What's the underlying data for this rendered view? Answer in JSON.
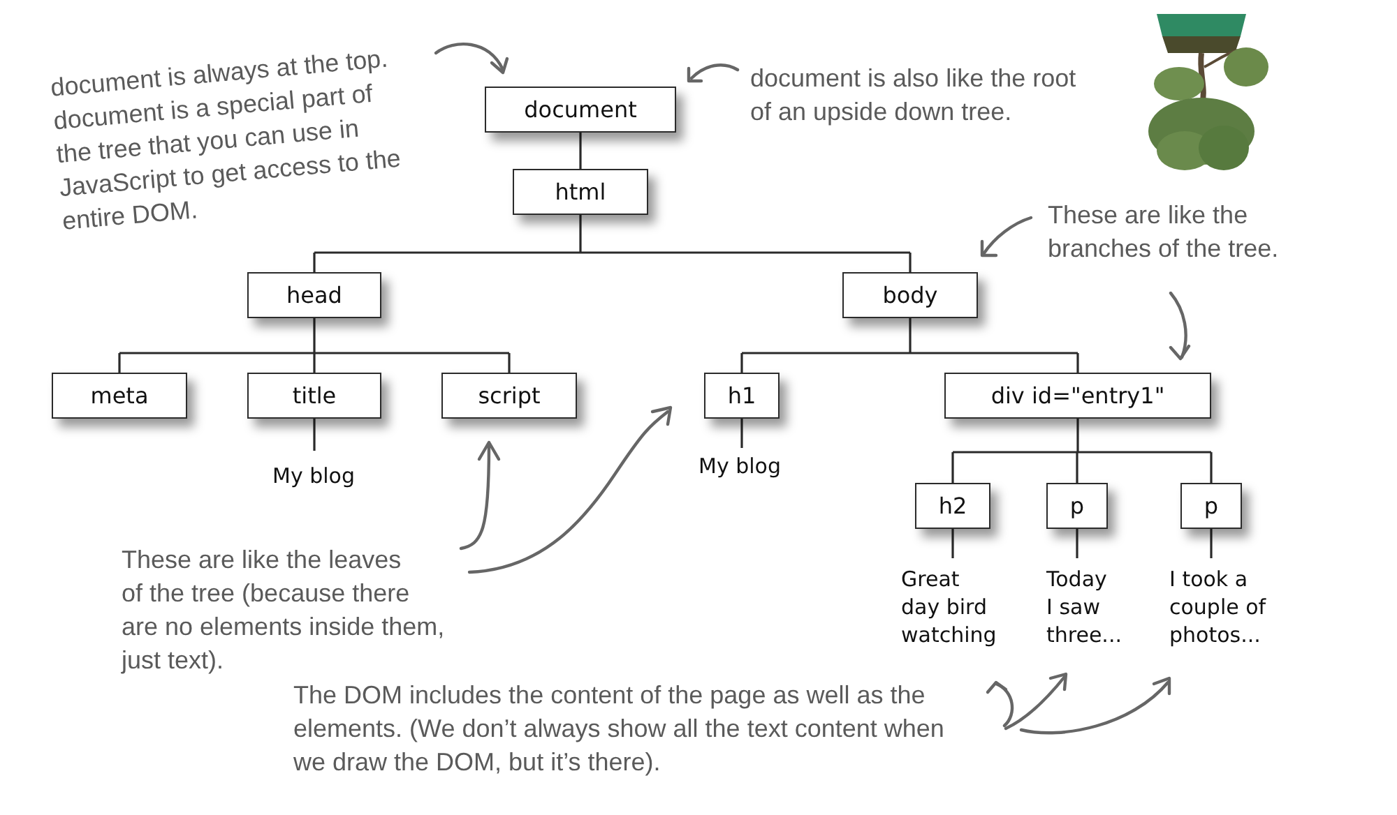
{
  "tree": {
    "kind": "element",
    "label": "document",
    "children": [
      {
        "kind": "element",
        "label": "html",
        "children": [
          {
            "kind": "element",
            "label": "head",
            "children": [
              {
                "kind": "element",
                "label": "meta"
              },
              {
                "kind": "element",
                "label": "title",
                "children": [
                  {
                    "kind": "text",
                    "text": "My blog"
                  }
                ]
              },
              {
                "kind": "element",
                "label": "script"
              }
            ]
          },
          {
            "kind": "element",
            "label": "body",
            "children": [
              {
                "kind": "element",
                "label": "h1",
                "children": [
                  {
                    "kind": "text",
                    "text": "My blog"
                  }
                ]
              },
              {
                "kind": "element",
                "label": "div id=\"entry1\"",
                "children": [
                  {
                    "kind": "element",
                    "label": "h2",
                    "children": [
                      {
                        "kind": "text",
                        "text": "Great\nday bird\nwatching"
                      }
                    ]
                  },
                  {
                    "kind": "element",
                    "label": "p",
                    "children": [
                      {
                        "kind": "text",
                        "text": "Today\nI saw\nthree..."
                      }
                    ]
                  },
                  {
                    "kind": "element",
                    "label": "p",
                    "children": [
                      {
                        "kind": "text",
                        "text": "I took a\ncouple of\nphotos..."
                      }
                    ]
                  }
                ]
              }
            ]
          }
        ]
      }
    ]
  },
  "annotations": [
    {
      "text": "document is always at the top.\ndocument is a special part of\nthe tree that you can use in\nJavaScript to get access to the\nentire DOM."
    },
    {
      "text": "document is also like the root\nof an upside down tree."
    },
    {
      "text": "These are like the\nbranches of the tree."
    },
    {
      "text": "These are like the leaves\nof the tree (because there\nare no elements inside them,\njust text)."
    },
    {
      "text": "The DOM includes the content of the page as well as the\nelements. (We don’t always show all the text content when\nwe draw the DOM, but it’s there)."
    }
  ]
}
